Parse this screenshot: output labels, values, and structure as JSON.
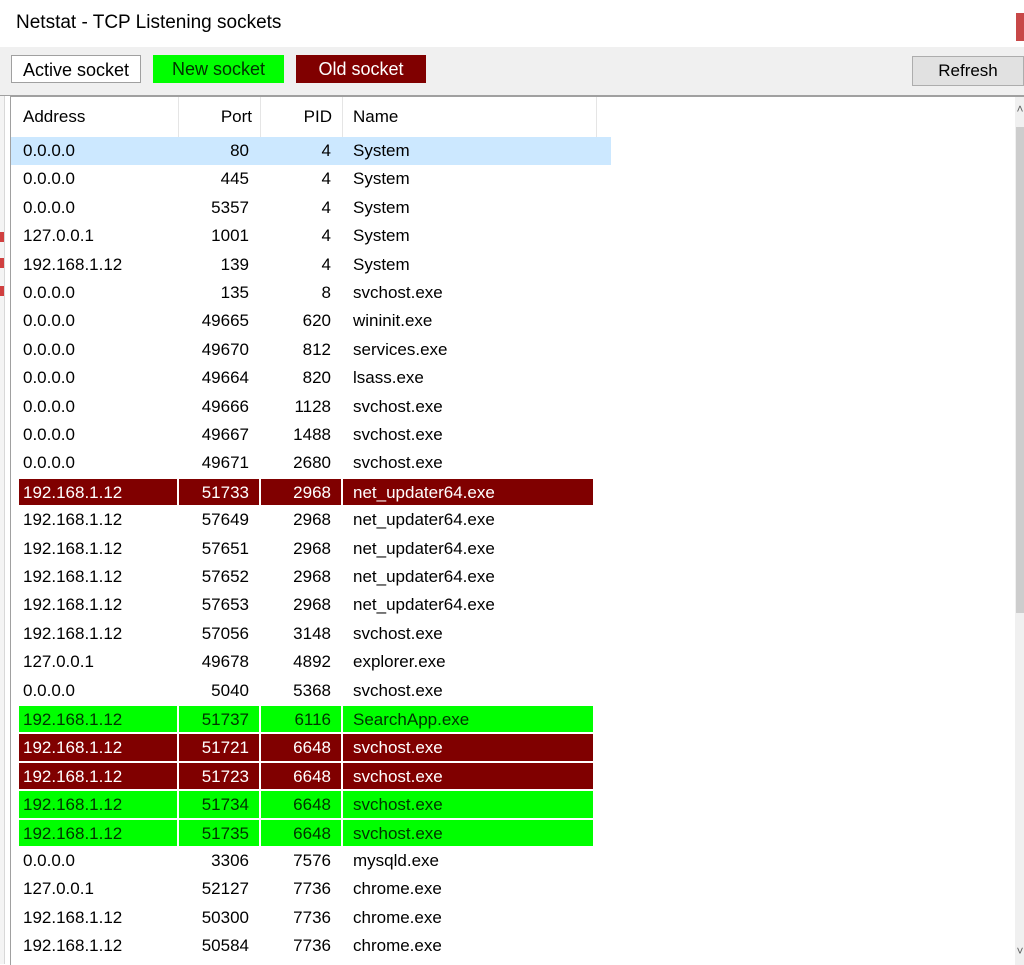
{
  "window": {
    "title": "Netstat - TCP Listening sockets"
  },
  "toolbar": {
    "legend_active": "Active socket",
    "legend_new": "New socket",
    "legend_old": "Old socket",
    "refresh_label": "Refresh"
  },
  "colors": {
    "new_socket": "#00ff00",
    "old_socket": "#800000",
    "selected": "#cce8ff"
  },
  "columns": [
    "Address",
    "Port",
    "PID",
    "Name"
  ],
  "rows": [
    {
      "address": "0.0.0.0",
      "port": "80",
      "pid": "4",
      "name": "System",
      "state": "selected"
    },
    {
      "address": "0.0.0.0",
      "port": "445",
      "pid": "4",
      "name": "System",
      "state": "normal"
    },
    {
      "address": "0.0.0.0",
      "port": "5357",
      "pid": "4",
      "name": "System",
      "state": "normal"
    },
    {
      "address": "127.0.0.1",
      "port": "1001",
      "pid": "4",
      "name": "System",
      "state": "normal"
    },
    {
      "address": "192.168.1.12",
      "port": "139",
      "pid": "4",
      "name": "System",
      "state": "normal"
    },
    {
      "address": "0.0.0.0",
      "port": "135",
      "pid": "8",
      "name": "svchost.exe",
      "state": "normal"
    },
    {
      "address": "0.0.0.0",
      "port": "49665",
      "pid": "620",
      "name": "wininit.exe",
      "state": "normal"
    },
    {
      "address": "0.0.0.0",
      "port": "49670",
      "pid": "812",
      "name": "services.exe",
      "state": "normal"
    },
    {
      "address": "0.0.0.0",
      "port": "49664",
      "pid": "820",
      "name": "lsass.exe",
      "state": "normal"
    },
    {
      "address": "0.0.0.0",
      "port": "49666",
      "pid": "1128",
      "name": "svchost.exe",
      "state": "normal"
    },
    {
      "address": "0.0.0.0",
      "port": "49667",
      "pid": "1488",
      "name": "svchost.exe",
      "state": "normal"
    },
    {
      "address": "0.0.0.0",
      "port": "49671",
      "pid": "2680",
      "name": "svchost.exe",
      "state": "normal"
    },
    {
      "address": "192.168.1.12",
      "port": "51733",
      "pid": "2968",
      "name": "net_updater64.exe",
      "state": "old"
    },
    {
      "address": "192.168.1.12",
      "port": "57649",
      "pid": "2968",
      "name": "net_updater64.exe",
      "state": "normal"
    },
    {
      "address": "192.168.1.12",
      "port": "57651",
      "pid": "2968",
      "name": "net_updater64.exe",
      "state": "normal"
    },
    {
      "address": "192.168.1.12",
      "port": "57652",
      "pid": "2968",
      "name": "net_updater64.exe",
      "state": "normal"
    },
    {
      "address": "192.168.1.12",
      "port": "57653",
      "pid": "2968",
      "name": "net_updater64.exe",
      "state": "normal"
    },
    {
      "address": "192.168.1.12",
      "port": "57056",
      "pid": "3148",
      "name": "svchost.exe",
      "state": "normal"
    },
    {
      "address": "127.0.0.1",
      "port": "49678",
      "pid": "4892",
      "name": "explorer.exe",
      "state": "normal"
    },
    {
      "address": "0.0.0.0",
      "port": "5040",
      "pid": "5368",
      "name": "svchost.exe",
      "state": "normal"
    },
    {
      "address": "192.168.1.12",
      "port": "51737",
      "pid": "6116",
      "name": "SearchApp.exe",
      "state": "new"
    },
    {
      "address": "192.168.1.12",
      "port": "51721",
      "pid": "6648",
      "name": "svchost.exe",
      "state": "old"
    },
    {
      "address": "192.168.1.12",
      "port": "51723",
      "pid": "6648",
      "name": "svchost.exe",
      "state": "old"
    },
    {
      "address": "192.168.1.12",
      "port": "51734",
      "pid": "6648",
      "name": "svchost.exe",
      "state": "new"
    },
    {
      "address": "192.168.1.12",
      "port": "51735",
      "pid": "6648",
      "name": "svchost.exe",
      "state": "new"
    },
    {
      "address": "0.0.0.0",
      "port": "3306",
      "pid": "7576",
      "name": "mysqld.exe",
      "state": "normal"
    },
    {
      "address": "127.0.0.1",
      "port": "52127",
      "pid": "7736",
      "name": "chrome.exe",
      "state": "normal"
    },
    {
      "address": "192.168.1.12",
      "port": "50300",
      "pid": "7736",
      "name": "chrome.exe",
      "state": "normal"
    },
    {
      "address": "192.168.1.12",
      "port": "50584",
      "pid": "7736",
      "name": "chrome.exe",
      "state": "normal"
    }
  ],
  "scrollbar": {
    "up_icon": "scroll-up-arrow-icon",
    "down_icon": "scroll-down-arrow-icon",
    "up_glyph": "˄",
    "down_glyph": "˅"
  }
}
